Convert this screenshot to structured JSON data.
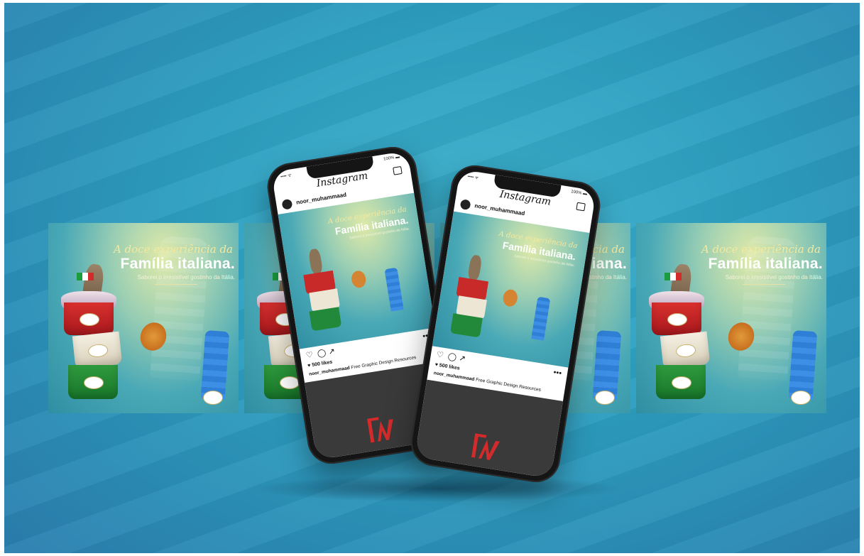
{
  "colors": {
    "background": "#2d9ec0",
    "brand_red": "#d32b2b",
    "headline": "#ffffff",
    "script": "#f3e9a0"
  },
  "post": {
    "script_line": "A doce experiência da",
    "headline": "Família italiana.",
    "subline": "Saborei o irresistível gostinho da Itália."
  },
  "instagram": {
    "title": "Instagram",
    "username": "noor_muhammaad",
    "likes": "♥ 500 likes",
    "caption_user": "noor_muhammaad",
    "caption_text": "Free Graphic Design Resources",
    "status_left": "•••• ᯤ",
    "status_right": "100% ▬",
    "more": "•••"
  },
  "icons": {
    "heart": "heart-icon",
    "comment": "comment-icon",
    "share": "share-icon",
    "inbox": "inbox-icon",
    "brand": "brand-logo-icon"
  }
}
